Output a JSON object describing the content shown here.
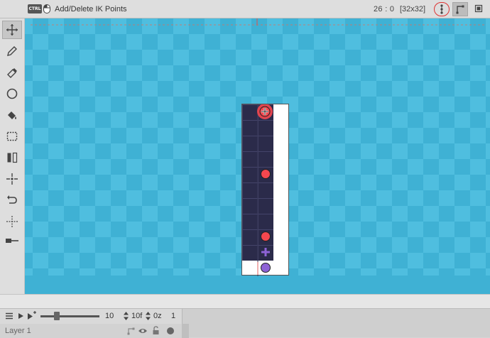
{
  "topbar": {
    "ctrl_key": "CTRL",
    "hint": "Add/Delete IK Points",
    "coords": "26 : 0",
    "grid_size": "[32x32]",
    "ik_tool_icon": "ik-chain-icon",
    "bone_tool_icon": "bone-icon",
    "frame_tool_icon": "frame-icon"
  },
  "tools": [
    "move-icon",
    "pencil-icon",
    "eraser-icon",
    "circle-icon",
    "bucket-icon",
    "selection-icon",
    "mirror-icon",
    "center-icon",
    "undo-icon",
    "transform-icon",
    "line-icon"
  ],
  "timeline": {
    "frame_value": "10",
    "fps": "10f",
    "offset": "0z",
    "current_frame": "1",
    "slider_fraction": 0.28
  },
  "layer": {
    "name": "Layer 1"
  },
  "colors": {
    "ik_point": "#f5474f",
    "ik_end": "#8e63d6",
    "sprite_dark": "#2b2b4a",
    "canvas": "#4fbedf"
  }
}
